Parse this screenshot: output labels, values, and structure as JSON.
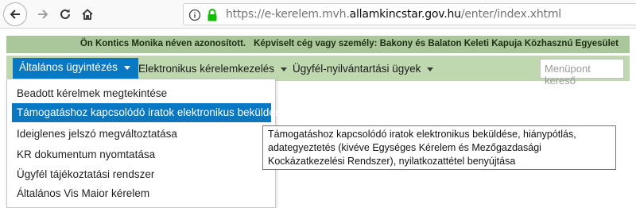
{
  "browser": {
    "url_prefix": "https://e-kerelem.mvh.",
    "url_domain": "allamkincstar.gov.hu",
    "url_path": "/enter/index.xhtml",
    "icons": [
      "back-icon",
      "forward-icon",
      "reload-icon",
      "home-icon",
      "info-icon",
      "lock-icon"
    ]
  },
  "infobar": {
    "identity": "Ön Kontics Monika néven azonosított.",
    "represented": "Képviselt cég vagy személy: Bakony és Balaton Keleti Kapuja Közhasznú Egyesület"
  },
  "menu": {
    "items": [
      {
        "label": "Általános ügyintézés"
      },
      {
        "label": "Elektronikus kérelemkezelés"
      },
      {
        "label": "Ügyfél-nyilvántartási ügyek"
      }
    ],
    "search_placeholder": "Menüpont kereső"
  },
  "dropdown": {
    "items": [
      {
        "label": "Beadott kérelmek megtekintése"
      },
      {
        "label": "Támogatáshoz kapcsolódó iratok elektronikus beküldése"
      },
      {
        "label": "Ideiglenes jelszó megváltoztatása"
      },
      {
        "label": "KR dokumentum nyomtatása"
      },
      {
        "label": "Ügyfél tájékoztatási rendszer"
      },
      {
        "label": "Általános Vis Maior kérelem"
      }
    ]
  },
  "tooltip": {
    "text": "Támogatáshoz kapcsolódó iratok elektronikus beküldése, hiánypótlás, adategyeztetés (kivéve Egységes Kérelem és Mezőgazdasági Kockázatkezelési Rendszer), nyilatkozattétel benyújtása"
  },
  "colors": {
    "accent": "#0a77c1",
    "infobar": "#a9c79a",
    "menubar": "#bfd8b0"
  }
}
